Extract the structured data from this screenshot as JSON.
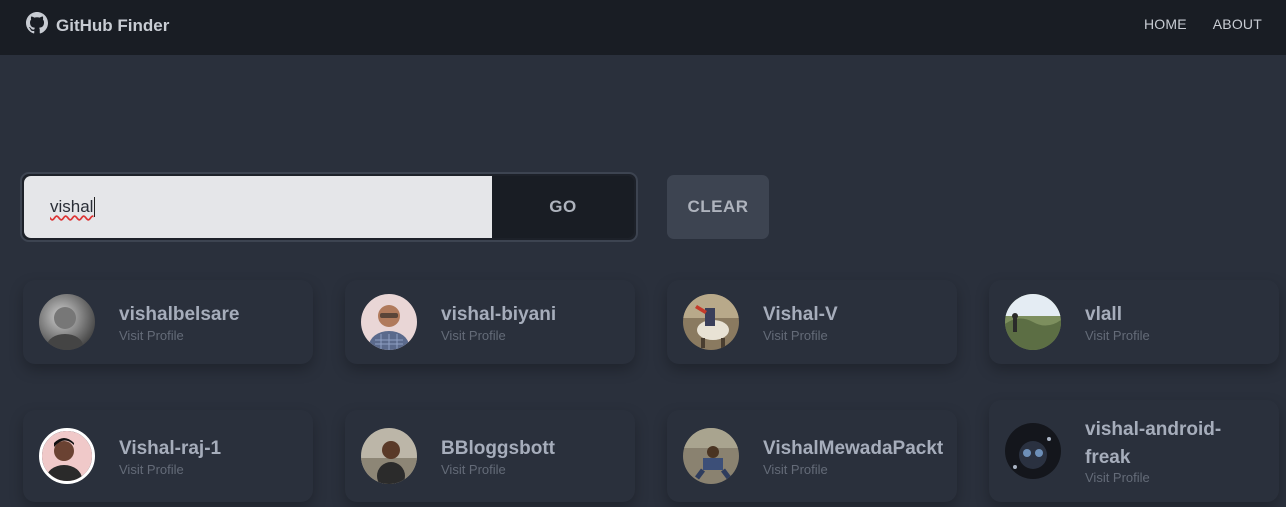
{
  "app": {
    "title": "GitHub Finder",
    "logo_icon": "github-icon"
  },
  "nav": {
    "items": [
      {
        "label": "HOME"
      },
      {
        "label": "ABOUT"
      }
    ]
  },
  "search": {
    "value": "vishal",
    "go_label": "GO",
    "clear_label": "CLEAR"
  },
  "users": [
    {
      "login": "vishalbelsare",
      "link": "Visit Profile"
    },
    {
      "login": "vishal-biyani",
      "link": "Visit Profile"
    },
    {
      "login": "Vishal-V",
      "link": "Visit Profile"
    },
    {
      "login": "vlall",
      "link": "Visit Profile"
    },
    {
      "login": "Vishal-raj-1",
      "link": "Visit Profile"
    },
    {
      "login": "BBloggsbott",
      "link": "Visit Profile"
    },
    {
      "login": "VishalMewadaPackt",
      "link": "Visit Profile"
    },
    {
      "login": "vishal-android-freak",
      "link": "Visit Profile"
    }
  ],
  "colors": {
    "background": "#2a303c",
    "navbar": "#191d24",
    "input": "#e5e6e9",
    "clear_button": "#3d4451"
  }
}
